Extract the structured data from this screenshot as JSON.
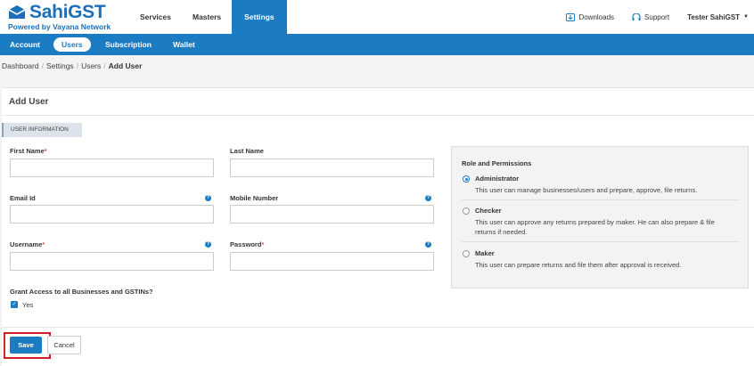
{
  "brand": {
    "name": "SahiGST",
    "tagline": "Powered by Vayana Network",
    "color": "#1c6fb9"
  },
  "main_nav": [
    {
      "label": "Services"
    },
    {
      "label": "Masters"
    },
    {
      "label": "Settings",
      "active": true
    }
  ],
  "right_nav": {
    "downloads": "Downloads",
    "support": "Support",
    "user": "Tester SahiGST"
  },
  "sub_nav": [
    {
      "label": "Account"
    },
    {
      "label": "Users",
      "active": true
    },
    {
      "label": "Subscription"
    },
    {
      "label": "Wallet"
    }
  ],
  "breadcrumb": [
    "Dashboard",
    "Settings",
    "Users",
    "Add User"
  ],
  "form": {
    "title": "Add User",
    "section": "USER INFORMATION",
    "fields": {
      "first_name": {
        "label": "First Name",
        "required": true,
        "value": ""
      },
      "last_name": {
        "label": "Last Name",
        "required": false,
        "value": ""
      },
      "email": {
        "label": "Email Id",
        "required": false,
        "value": ""
      },
      "mobile": {
        "label": "Mobile Number",
        "required": false,
        "value": ""
      },
      "username": {
        "label": "Username",
        "required": true,
        "value": ""
      },
      "password": {
        "label": "Password",
        "required": true,
        "value": ""
      }
    },
    "grant_access": {
      "label": "Grant Access to all Businesses and GSTINs?",
      "option": "Yes",
      "checked": true
    },
    "save": "Save",
    "cancel": "Cancel"
  },
  "roles": {
    "title": "Role and Permissions",
    "items": [
      {
        "name": "Administrator",
        "desc": "This user can manage businesses/users and prepare, approve, file returns.",
        "selected": true
      },
      {
        "name": "Checker",
        "desc": "This user can approve any returns prepared by maker. He can also prepare & file returns if needed.",
        "selected": false
      },
      {
        "name": "Maker",
        "desc": "This user can prepare returns and file them after approval is received.",
        "selected": false
      }
    ]
  },
  "colors": {
    "primary": "#1b7cc4",
    "highlight": "#d21e25",
    "required": "#d9534f"
  }
}
